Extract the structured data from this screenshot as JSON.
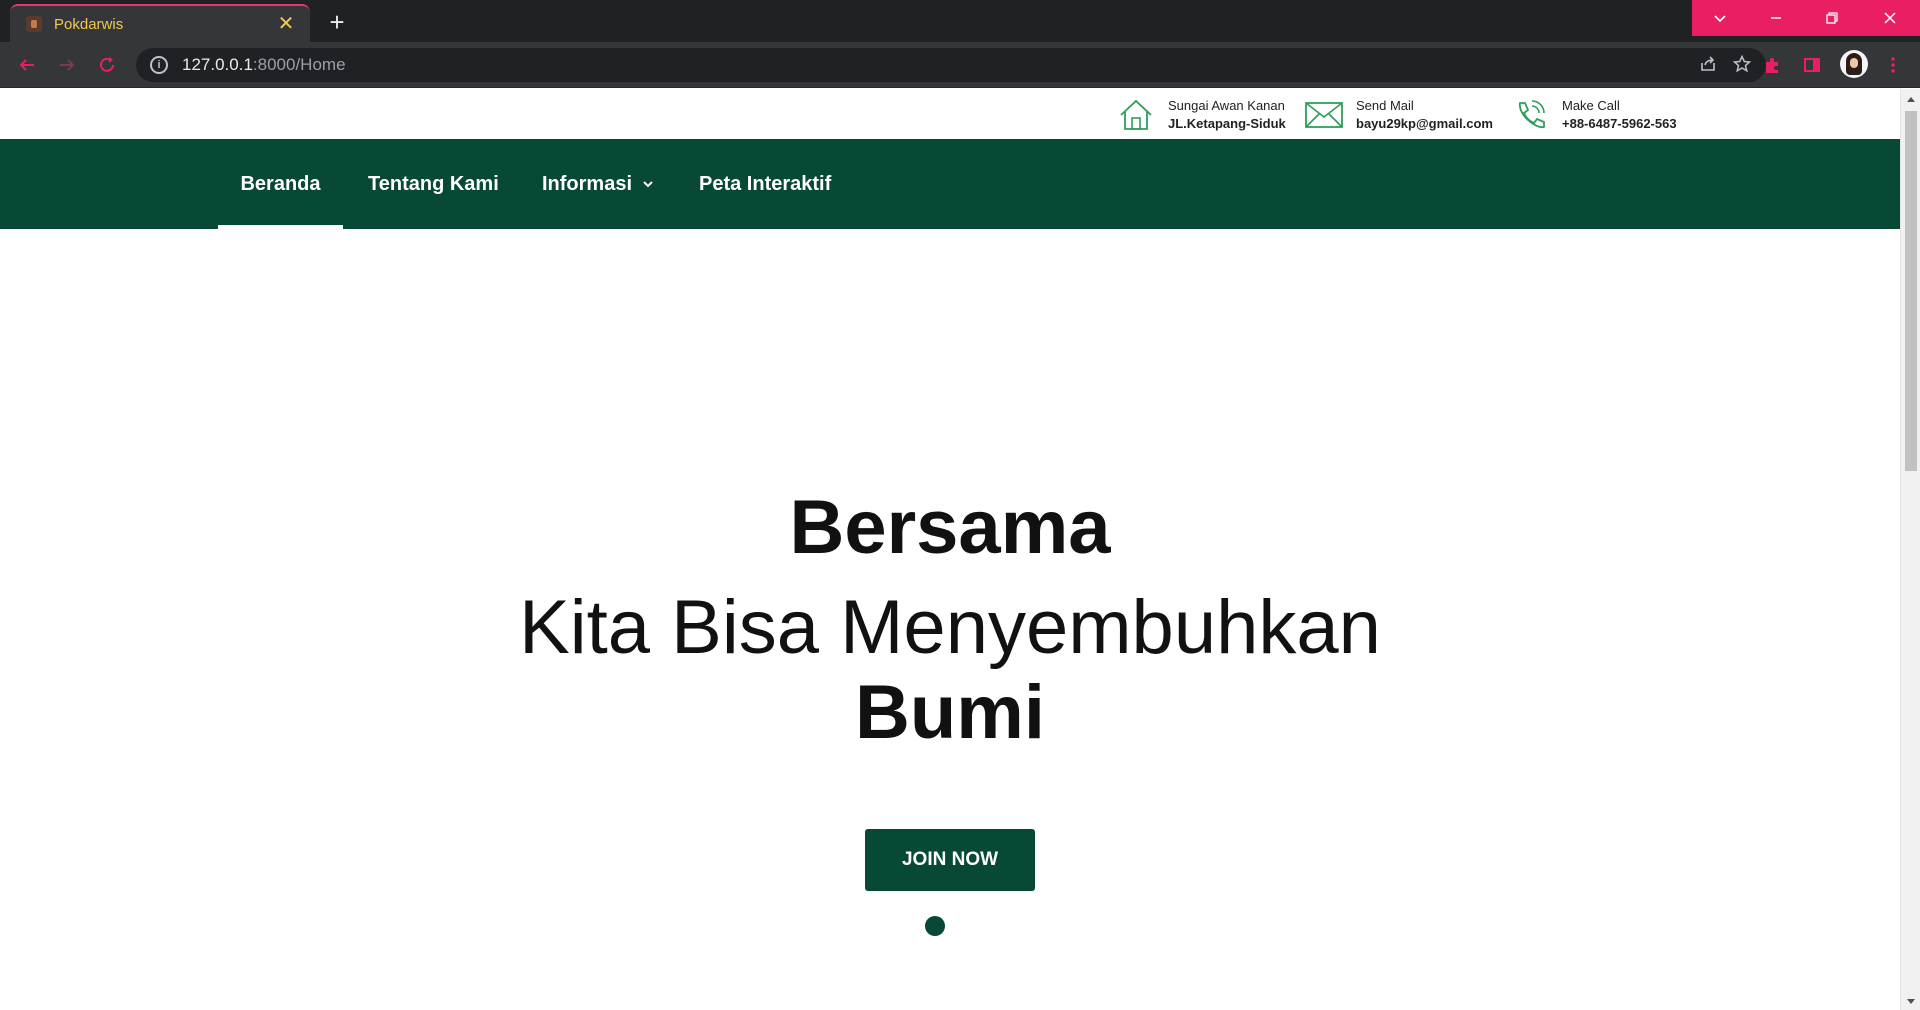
{
  "browser": {
    "tab_title": "Pokdarwis",
    "tab_close": "✕",
    "new_tab": "+",
    "url_host": "127.0.0.1",
    "url_path": ":8000/Home",
    "accent_color": "#e91e63"
  },
  "top_info": {
    "address": {
      "line1": "Sungai Awan Kanan",
      "line2": "JL.Ketapang-Siduk",
      "icon": "home-icon"
    },
    "mail": {
      "line1": "Send Mail",
      "line2": "bayu29kp@gmail.com",
      "icon": "mail-icon"
    },
    "call": {
      "line1": "Make Call",
      "line2": "+88-6487-5962-563",
      "icon": "phone-icon"
    }
  },
  "nav": {
    "items": [
      {
        "label": "Beranda",
        "active": true
      },
      {
        "label": "Tentang Kami",
        "active": false
      },
      {
        "label": "Informasi",
        "active": false,
        "dropdown": true
      },
      {
        "label": "Peta Interaktif",
        "active": false
      }
    ],
    "background": "#074836"
  },
  "hero": {
    "line1": "Bersama",
    "line2": "Kita Bisa Menyembuhkan",
    "line3": "Bumi",
    "button_label": "JOIN NOW",
    "slides_count": 1,
    "active_slide": 1
  }
}
